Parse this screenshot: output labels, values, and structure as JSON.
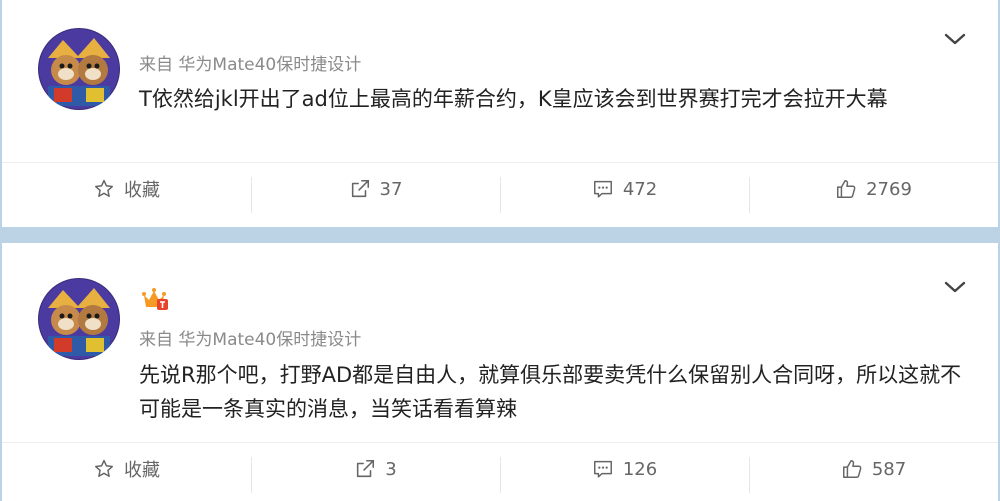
{
  "posts": [
    {
      "source": "来自 华为Mate40保时捷设计",
      "text": "T依然给jkl开出了ad位上最高的年薪合约，K皇应该会到世界赛打完才会拉开大幕",
      "actions": {
        "favorite_label": "收藏",
        "share_count": "37",
        "comment_count": "472",
        "like_count": "2769"
      }
    },
    {
      "source": "来自 华为Mate40保时捷设计",
      "text": "先说R那个吧，打野AD都是自由人，就算俱乐部要卖凭什么保留别人合同呀，所以这就不可能是一条真实的消息，当笑话看看算辣",
      "actions": {
        "favorite_label": "收藏",
        "share_count": "3",
        "comment_count": "126",
        "like_count": "587"
      }
    }
  ],
  "icons": {
    "favorite": "star-outline-icon",
    "share": "share-icon",
    "comment": "comment-icon",
    "like": "thumbs-up-icon",
    "menu": "chevron-down-icon",
    "badge": "crown-badge-icon"
  },
  "colors": {
    "page_background": "#bcd3e6",
    "card_background": "#ffffff",
    "source_text": "#8a8a8a",
    "body_text": "#222222",
    "action_text": "#666666",
    "badge_orange": "#f59a23"
  }
}
